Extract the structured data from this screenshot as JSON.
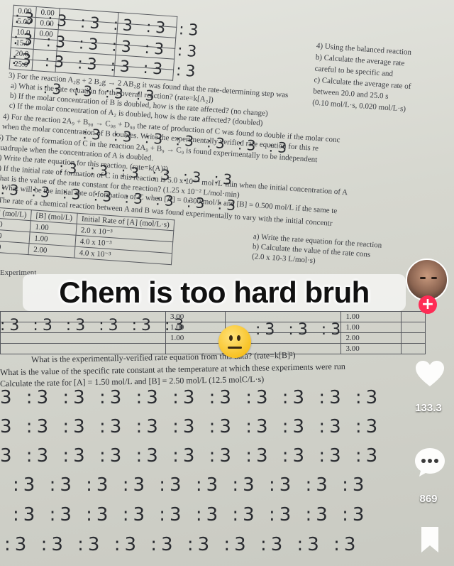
{
  "video": {
    "caption": "Chem is too hard bruh",
    "emoji": "neutral-face-emoji"
  },
  "worksheet": {
    "table_top": {
      "rows": [
        [
          "0.00",
          "0.00",
          "",
          ""
        ],
        [
          "5.00",
          "0.00",
          "",
          ""
        ],
        [
          "10.0",
          "0.00",
          "",
          ""
        ],
        [
          "15.0",
          "",
          "",
          ""
        ],
        [
          "20.0",
          "",
          "",
          ""
        ],
        [
          "25.0",
          "",
          "",
          ""
        ]
      ]
    },
    "lines_upper": [
      "3) For the reaction  A₂g + 2 B₂g → 2 AB₂g  it was found that the rate-determining step was",
      "a) What is the rate equation for the overall reaction?   (rate=k[A₂])",
      "b) If the molar concentration of B is doubled, how is the rate affected? (no change)",
      "c) If the molar concentration of A₂ is doubled, how is the rate affected? (doubled)",
      "4) For the reaction 2A₉ + B₉₈ → C₉₈ + D₉₈  the rate of production of C was found to double if the molar conc",
      "when the molar concentration of B doubles. Write the experimentally verified rate equation for this re",
      "5) The rate of formation of C in the reaction 2A₉ + B₉ → C₉ is found experimentally to be independent",
      "quadruple when the concentration of A is doubled.",
      "a) Write the rate equation for this reaction.  (rate=k(A)²)",
      "b) If the initial rate of formation of C in this reaction is 5.0 x 10⁻⁴ mol /L·min when the initial concentration of A",
      "what is the value of the rate constant for the reaction? (1.25 x 10⁻² L/mol·min)",
      "c) What will be the initial rate of formation of C when [A] = 0.300 mol/L and [B] = 0.500 mol/L if the same te",
      "7) The rate of a chemical reaction between A and B was found experimentally to vary with the initial concentr"
    ],
    "table_mid": {
      "headers": [
        "[A] (mol/L)",
        "[B] (mol/L)",
        "Initial Rate of [A] (mol/L·s)"
      ],
      "rows": [
        [
          "1.00",
          "1.00",
          "2.0 x 10⁻³"
        ],
        [
          "2.00",
          "1.00",
          "4.0 x 10⁻³"
        ],
        [
          "1.00",
          "2.00",
          "4.0 x 10⁻³"
        ]
      ]
    },
    "side_notes": [
      "a) Write the rate equation for the reaction",
      "b) Calculate the value of the rate cons",
      "(2.0 x 10-3 L/mol·s)"
    ],
    "experiment_label": "Experiment",
    "table_low": {
      "left_values": [
        "3.00",
        "1.00",
        "1.00"
      ],
      "right_values": [
        "1.00",
        "1.00",
        "2.00",
        "3.00"
      ]
    },
    "lines_lower": [
      "What is the experimentally-verified rate equation from this data? (rate=k[B]²)",
      "What is the value of the specific rate constant at the temperature at which these experiments were run",
      "Calculate the rate for [A] = 1.50 mol/L and [B] = 2.50 mol/L   (12.5 molC/L·s)"
    ],
    "scribble_rows": [
      "3 :3 :3 :3 :3 :3 :3 :3 :3 :3 :3",
      "3 :3 :3 :3 :3 :3 :3 :3 :3 :3 :3",
      "3 :3 :3 :3 :3 :3 :3 :3 :3 :3 :3",
      ":3 :3 :3 :3 :3 :3 :3 :3 :3 :3",
      ":3 :3 :3 :3 :3 :3 :3 :3 :3 :3",
      ":3 :3 :3 :3 :3 :3 :3 :3 :3 :3"
    ],
    "right_column_notes": [
      "4) Using the balanced reaction",
      "b) Calculate the average rate",
      "careful to be specific and",
      "c) Calculate the average rate of",
      "between 20.0 and 25.0 s",
      "(0.10 mol/L·s, 0.020 mol/L·s)"
    ]
  },
  "sidebar": {
    "likes": "133.3",
    "comments": "869"
  },
  "colors": {
    "follow": "#fe2c55",
    "paper": "#d6d7cf"
  }
}
